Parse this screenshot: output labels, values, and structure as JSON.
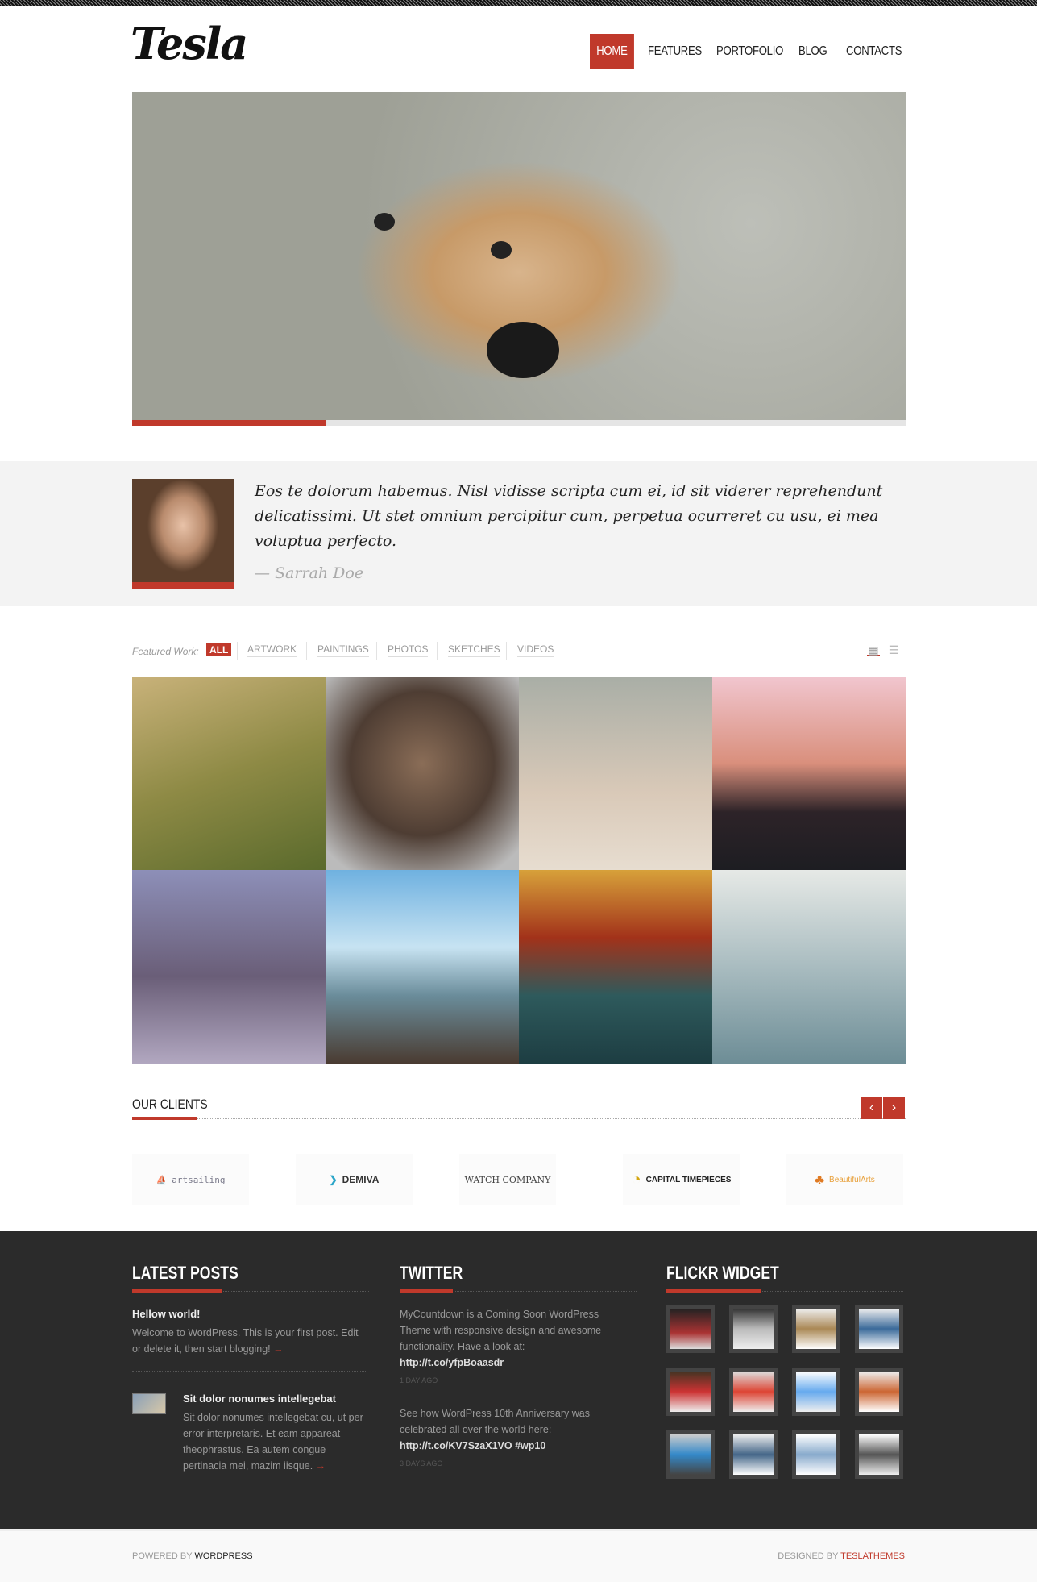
{
  "header": {
    "logo": "Tesla",
    "nav": [
      "Home",
      "Features",
      "Portofolio",
      "Blog",
      "Contacts"
    ],
    "active": 0
  },
  "slider": {
    "progress": 0.25
  },
  "testimonial": {
    "quote": "Eos te dolorum habemus. Nisl vidisse scripta cum ei, id sit viderer reprehendunt delicatissimi. Ut stet omnium percipitur cum, perpetua ocurreret cu usu, ei mea voluptua perfecto.",
    "author": "— Sarrah Doe"
  },
  "portfolio": {
    "label": "Featured Work:",
    "filters": [
      "All",
      "Artwork",
      "Paintings",
      "Photos",
      "Sketches",
      "Videos"
    ],
    "active": 0,
    "view_icons": [
      "grid-view-icon",
      "list-view-icon"
    ]
  },
  "clients": {
    "title": "Our Clients",
    "prev": "‹",
    "next": "›",
    "logos": [
      "artsailing",
      "DEMIVA",
      "WATCH COMPANY",
      "CAPITAL TIMEPIECES",
      "BeautifulArts"
    ]
  },
  "footer": {
    "latest_posts": {
      "title": "Latest Posts",
      "posts": [
        {
          "title": "Hellow world!",
          "excerpt": "Welcome to WordPress. This is your first post. Edit or delete it, then start blogging!"
        },
        {
          "title": "Sit dolor nonumes intellegebat",
          "excerpt": "Sit dolor nonumes intellegebat cu, ut per error interpretaris. Et eam appareat theophrastus. Ea autem congue pertinacia mei, mazim iisque."
        }
      ],
      "more": "→"
    },
    "twitter": {
      "title": "Twitter",
      "tweets": [
        {
          "text": "MyCountdown is a Coming Soon WordPress Theme with responsive design and awesome functionality. Have a look at:",
          "link": "http://t.co/yfpBoaasdr",
          "time": "1 day ago"
        },
        {
          "text": "See how WordPress 10th Anniversary was celebrated all over the world here:",
          "link": "http://t.co/KV7SzaX1VO #wp10",
          "time": "3 days ago"
        }
      ]
    },
    "flickr": {
      "title": "Flickr Widget"
    }
  },
  "bottom": {
    "powered_prefix": "Powered by",
    "powered_link": "WordPress",
    "designed_prefix": "Designed by",
    "designed_link": "TeslaThemes"
  },
  "colors": {
    "accent": "#c0392b",
    "footer_bg": "#2b2b2b"
  }
}
